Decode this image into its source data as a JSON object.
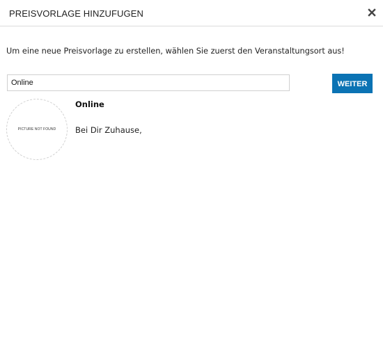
{
  "dialog": {
    "title": "PREISVORLAGE HINZUFUGEN",
    "close_icon": "close-icon"
  },
  "main": {
    "instruction": "Um eine neue Preisvorlage zu erstellen, wählen Sie zuerst den Veranstaltungsort aus!",
    "search": {
      "value": "Online"
    },
    "next_button_label": "WEITER",
    "results": [
      {
        "thumbnail_text": "PICTURE NOT FOUND",
        "title": "Online",
        "description": "Bei Dir Zuhause,"
      }
    ]
  },
  "colors": {
    "accent": "#0b73b4",
    "divider": "#dcdcdc"
  }
}
